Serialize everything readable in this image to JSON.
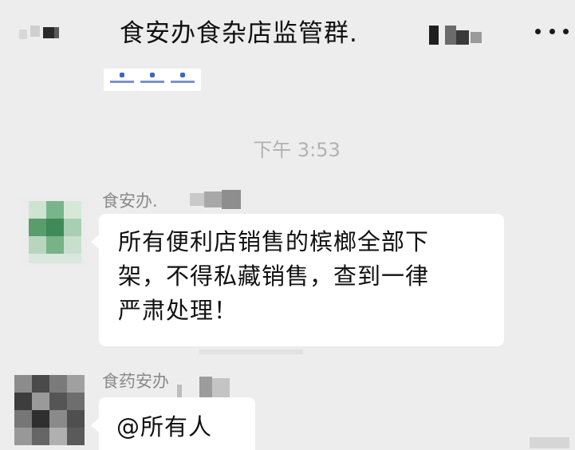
{
  "header": {
    "title": "食安办食杂店监管群.",
    "more_icon": "more-dots-icon"
  },
  "timestamp": "下午 3:53",
  "messages": [
    {
      "sender": "食安办.",
      "text": "所有便利店销售的槟榔全部下\n架，不得私藏销售，查到一律\n严肃处理！"
    },
    {
      "sender": "食药安办",
      "text": "@所有人"
    }
  ],
  "colors": {
    "background": "#ededed",
    "bubble": "#ffffff",
    "timestamp": "#b2b2b2",
    "sender": "#8a8a8a"
  }
}
